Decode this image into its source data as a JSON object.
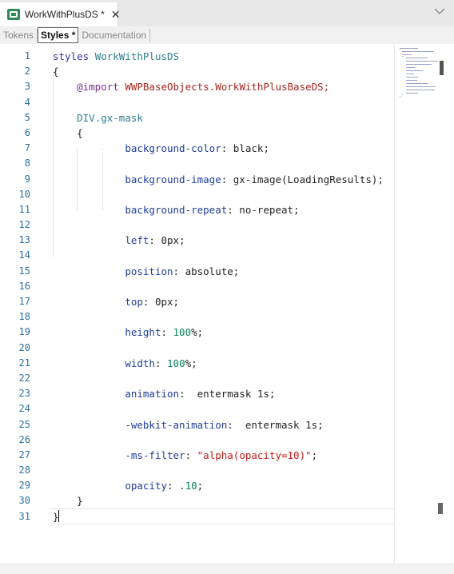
{
  "document_tab": {
    "title": "WorkWithPlusDS *",
    "close_glyph": "✕",
    "icon": "grid-object-icon"
  },
  "subtabs": [
    {
      "label": "Tokens"
    },
    {
      "label": "Styles *"
    },
    {
      "label": "Documentation"
    }
  ],
  "editor": {
    "line_numbers": [
      "1",
      "2",
      "3",
      "4",
      "5",
      "6",
      "7",
      "8",
      "9",
      "10",
      "11",
      "12",
      "13",
      "14",
      "15",
      "16",
      "17",
      "18",
      "19",
      "20",
      "21",
      "22",
      "23",
      "24",
      "25",
      "26",
      "27",
      "28",
      "29",
      "30",
      "31"
    ],
    "lines": [
      [
        [
          "styles ",
          "kw"
        ],
        [
          "WorkWithPlusDS",
          "cls"
        ]
      ],
      [
        [
          "{",
          "val"
        ]
      ],
      [
        [
          "    ",
          "val"
        ],
        [
          "@import ",
          "imp"
        ],
        [
          "WWPBaseObjects.WorkWithPlusBaseDS;",
          "ref"
        ]
      ],
      [],
      [
        [
          "    ",
          "val"
        ],
        [
          "DIV",
          "cls"
        ],
        [
          ".gx-mask",
          "cls"
        ]
      ],
      [
        [
          "    {",
          "val"
        ]
      ],
      [
        [
          "            ",
          "val"
        ],
        [
          "background-color",
          "prop"
        ],
        [
          ": black;",
          "val"
        ]
      ],
      [],
      [
        [
          "            ",
          "val"
        ],
        [
          "background-image",
          "prop"
        ],
        [
          ": gx-image(LoadingResults);",
          "val"
        ]
      ],
      [],
      [
        [
          "            ",
          "val"
        ],
        [
          "background-repeat",
          "prop"
        ],
        [
          ": no-repeat;",
          "val"
        ]
      ],
      [],
      [
        [
          "            ",
          "val"
        ],
        [
          "left",
          "prop"
        ],
        [
          ": 0px;",
          "val"
        ]
      ],
      [],
      [
        [
          "            ",
          "val"
        ],
        [
          "position",
          "prop"
        ],
        [
          ": absolute;",
          "val"
        ]
      ],
      [],
      [
        [
          "            ",
          "val"
        ],
        [
          "top",
          "prop"
        ],
        [
          ": 0px;",
          "val"
        ]
      ],
      [],
      [
        [
          "            ",
          "val"
        ],
        [
          "height",
          "prop"
        ],
        [
          ": ",
          "val"
        ],
        [
          "100",
          "num"
        ],
        [
          "%;",
          "val"
        ]
      ],
      [],
      [
        [
          "            ",
          "val"
        ],
        [
          "width",
          "prop"
        ],
        [
          ": ",
          "val"
        ],
        [
          "100",
          "num"
        ],
        [
          "%;",
          "val"
        ]
      ],
      [],
      [
        [
          "            ",
          "val"
        ],
        [
          "animation",
          "prop"
        ],
        [
          ":  entermask 1s;",
          "val"
        ]
      ],
      [],
      [
        [
          "            ",
          "val"
        ],
        [
          "-webkit-animation",
          "prop"
        ],
        [
          ":  entermask 1s;",
          "val"
        ]
      ],
      [],
      [
        [
          "            ",
          "val"
        ],
        [
          "-ms-filter",
          "prop"
        ],
        [
          ": ",
          "val"
        ],
        [
          "\"alpha(opacity=10)\"",
          "str"
        ],
        [
          ";",
          "val"
        ]
      ],
      [],
      [
        [
          "            ",
          "val"
        ],
        [
          "opacity",
          "prop"
        ],
        [
          ": .",
          "val"
        ],
        [
          "10",
          "num"
        ],
        [
          ";",
          "val"
        ]
      ],
      [
        [
          "    }",
          "val"
        ]
      ],
      [
        [
          "}",
          "val"
        ]
      ]
    ]
  },
  "colors": {
    "kw": "#333399",
    "prop": "#1f3d99",
    "num": "#098658",
    "str": "#c41a16",
    "ref": "#a3271f"
  }
}
